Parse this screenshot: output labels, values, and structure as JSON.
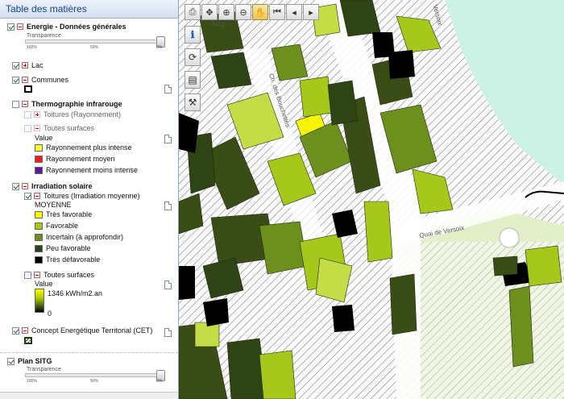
{
  "toc": {
    "title": "Table des matières",
    "energie": {
      "label": "Energie - Données générales",
      "transparence": "Transparence",
      "t100": "100%",
      "t50": "50%",
      "t0": "0%"
    },
    "lac": {
      "label": "Lac"
    },
    "communes": {
      "label": "Communes"
    },
    "thermo": {
      "label": "Thermographie infrarouge",
      "toitures": "Toitures (Rayonnement)",
      "toutes": "Toutes surfaces",
      "value": "Value",
      "items": [
        {
          "label": "Rayonnement plus intense",
          "color": "#ffff33"
        },
        {
          "label": "Rayonnement moyen",
          "color": "#ee1e1e"
        },
        {
          "label": "Rayonnement moins intense",
          "color": "#5a189e"
        }
      ]
    },
    "irradiation": {
      "label": "Irradiation solaire",
      "toitures": "Toitures (Irradiation moyenne)",
      "moyenne": "MOYENNE",
      "items": [
        {
          "label": "Très favorable",
          "color": "#ffff00"
        },
        {
          "label": "Favorable",
          "color": "#a6c81a"
        },
        {
          "label": "Incertain (à approfondir)",
          "color": "#6d8f1e"
        },
        {
          "label": "Peu favorable",
          "color": "#2f4414"
        },
        {
          "label": "Très défavorable",
          "color": "#000000"
        }
      ],
      "toutes": "Toutes surfaces",
      "value": "Value",
      "max": "1346 kWh/m2.an",
      "min": "0"
    },
    "cet": {
      "label": "Concept Energétique Territorial (CET)"
    },
    "plan": {
      "label": "Plan SITG",
      "transparence": "Transparence",
      "t100": "100%",
      "t50": "50%",
      "t0": "0%"
    }
  },
  "map": {
    "streets": {
      "surg": "Surg",
      "bouchet": "Ch. des Bouchettes",
      "quai": "Quai de Versoix",
      "top": "Versoix"
    },
    "toolbar": [
      {
        "name": "print-icon",
        "glyph": "⎙"
      },
      {
        "name": "move-cross-icon",
        "glyph": "✥"
      },
      {
        "name": "zoom-in-icon",
        "glyph": "⊕"
      },
      {
        "name": "zoom-out-icon",
        "glyph": "⊖"
      },
      {
        "name": "pan-hand-icon",
        "glyph": "✋"
      },
      {
        "name": "history-first-icon",
        "glyph": "⏮"
      },
      {
        "name": "history-back-icon",
        "glyph": "◂"
      },
      {
        "name": "history-forward-icon",
        "glyph": "▸"
      }
    ],
    "sidetools": [
      {
        "name": "info-icon",
        "glyph": "ℹ"
      },
      {
        "name": "refresh-icon",
        "glyph": "⟳"
      },
      {
        "name": "legend-icon",
        "glyph": "▤"
      },
      {
        "name": "measure-icon",
        "glyph": "⚒"
      }
    ],
    "colors": {
      "very_good": "#ffff00",
      "good": "#a6c81a",
      "uncertain": "#6d8f1e",
      "poor": "#2f4414",
      "bad": "#000000",
      "lake": "#ccf2e6",
      "green": "#e3efc9"
    }
  }
}
